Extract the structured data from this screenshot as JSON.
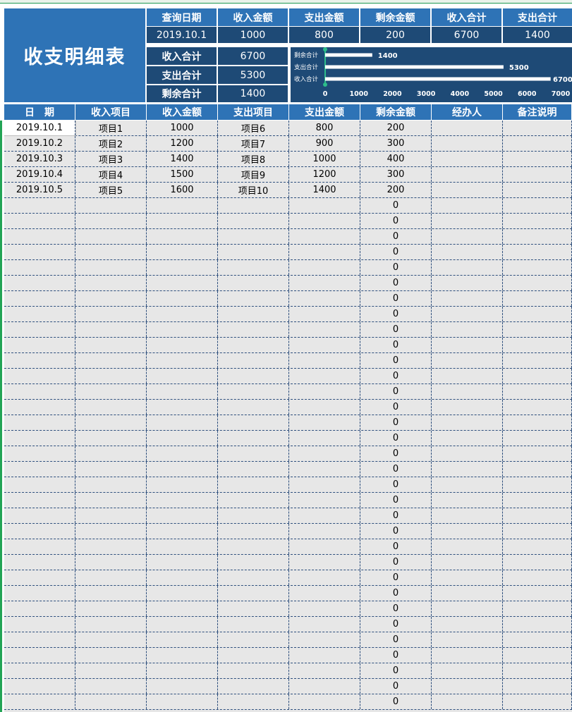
{
  "title": "收支明细表",
  "summary": {
    "headers": [
      "查询日期",
      "收入金额",
      "支出金额",
      "剩余金额",
      "收入合计",
      "支出合计"
    ],
    "values": [
      "2019.10.1",
      "1000",
      "800",
      "200",
      "6700",
      "1400"
    ]
  },
  "totals": [
    {
      "label": "收入合计",
      "value": "6700"
    },
    {
      "label": "支出合计",
      "value": "5300"
    },
    {
      "label": "剩余合计",
      "value": "1400"
    }
  ],
  "chart_data": {
    "type": "bar",
    "orientation": "horizontal",
    "categories": [
      "剩余合计",
      "支出合计",
      "收入合计"
    ],
    "values": [
      1400,
      5300,
      6700
    ],
    "value_labels": [
      "1400",
      "5300",
      "6700"
    ],
    "xlim": [
      0,
      7000
    ],
    "xticks": [
      "0",
      "1000",
      "2000",
      "3000",
      "4000",
      "5000",
      "6000",
      "7000"
    ],
    "grid": false,
    "bar_color": "#ffffff",
    "axis_color": "#2dbd8a"
  },
  "table": {
    "columns": [
      "日　期",
      "收入项目",
      "收入金额",
      "支出项目",
      "支出金额",
      "剩余金额",
      "经办人",
      "备注说明"
    ],
    "rows": [
      [
        "2019.10.1",
        "项目1",
        "1000",
        "项目6",
        "800",
        "200",
        "",
        ""
      ],
      [
        "2019.10.2",
        "项目2",
        "1200",
        "项目7",
        "900",
        "300",
        "",
        ""
      ],
      [
        "2019.10.3",
        "项目3",
        "1400",
        "项目8",
        "1000",
        "400",
        "",
        ""
      ],
      [
        "2019.10.4",
        "项目4",
        "1500",
        "项目9",
        "1200",
        "300",
        "",
        ""
      ],
      [
        "2019.10.5",
        "项目5",
        "1600",
        "项目10",
        "1400",
        "200",
        "",
        ""
      ],
      [
        "",
        "",
        "",
        "",
        "",
        "0",
        "",
        ""
      ],
      [
        "",
        "",
        "",
        "",
        "",
        "0",
        "",
        ""
      ],
      [
        "",
        "",
        "",
        "",
        "",
        "0",
        "",
        ""
      ],
      [
        "",
        "",
        "",
        "",
        "",
        "0",
        "",
        ""
      ],
      [
        "",
        "",
        "",
        "",
        "",
        "0",
        "",
        ""
      ],
      [
        "",
        "",
        "",
        "",
        "",
        "0",
        "",
        ""
      ],
      [
        "",
        "",
        "",
        "",
        "",
        "0",
        "",
        ""
      ],
      [
        "",
        "",
        "",
        "",
        "",
        "0",
        "",
        ""
      ],
      [
        "",
        "",
        "",
        "",
        "",
        "0",
        "",
        ""
      ],
      [
        "",
        "",
        "",
        "",
        "",
        "0",
        "",
        ""
      ],
      [
        "",
        "",
        "",
        "",
        "",
        "0",
        "",
        ""
      ],
      [
        "",
        "",
        "",
        "",
        "",
        "0",
        "",
        ""
      ],
      [
        "",
        "",
        "",
        "",
        "",
        "0",
        "",
        ""
      ],
      [
        "",
        "",
        "",
        "",
        "",
        "0",
        "",
        ""
      ],
      [
        "",
        "",
        "",
        "",
        "",
        "0",
        "",
        ""
      ],
      [
        "",
        "",
        "",
        "",
        "",
        "0",
        "",
        ""
      ],
      [
        "",
        "",
        "",
        "",
        "",
        "0",
        "",
        ""
      ],
      [
        "",
        "",
        "",
        "",
        "",
        "0",
        "",
        ""
      ],
      [
        "",
        "",
        "",
        "",
        "",
        "0",
        "",
        ""
      ],
      [
        "",
        "",
        "",
        "",
        "",
        "0",
        "",
        ""
      ],
      [
        "",
        "",
        "",
        "",
        "",
        "0",
        "",
        ""
      ],
      [
        "",
        "",
        "",
        "",
        "",
        "0",
        "",
        ""
      ],
      [
        "",
        "",
        "",
        "",
        "",
        "0",
        "",
        ""
      ],
      [
        "",
        "",
        "",
        "",
        "",
        "0",
        "",
        ""
      ],
      [
        "",
        "",
        "",
        "",
        "",
        "0",
        "",
        ""
      ],
      [
        "",
        "",
        "",
        "",
        "",
        "0",
        "",
        ""
      ],
      [
        "",
        "",
        "",
        "",
        "",
        "0",
        "",
        ""
      ],
      [
        "",
        "",
        "",
        "",
        "",
        "0",
        "",
        ""
      ],
      [
        "",
        "",
        "",
        "",
        "",
        "0",
        "",
        ""
      ],
      [
        "",
        "",
        "",
        "",
        "",
        "0",
        "",
        ""
      ],
      [
        "",
        "",
        "",
        "",
        "",
        "0",
        "",
        ""
      ],
      [
        "",
        "",
        "",
        "",
        "",
        "0",
        "",
        ""
      ],
      [
        "",
        "",
        "",
        "",
        "",
        "0",
        "",
        ""
      ]
    ]
  },
  "colors": {
    "header_blue": "#2e73b6",
    "dark_navy": "#1e4a76",
    "grid_bg": "#e7e7e7",
    "grid_line": "#2e4f7d",
    "selection_green": "#23a455"
  }
}
